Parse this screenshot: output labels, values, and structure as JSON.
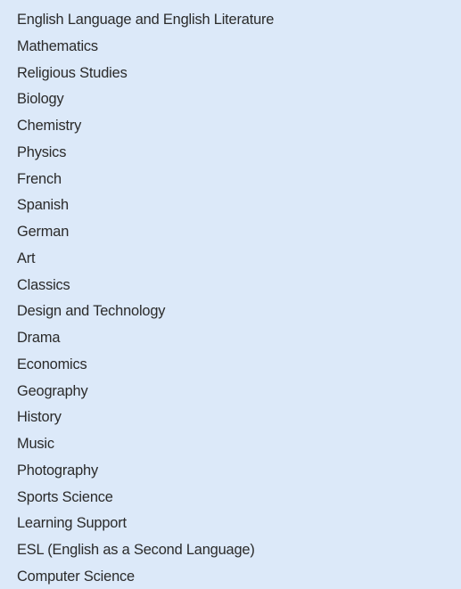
{
  "panel": {
    "name": "subject-list",
    "background_color": "#dce9f9",
    "text_color": "#2a2a2a",
    "item_count": 22
  },
  "subjects": [
    {
      "label": "English Language and English Literature"
    },
    {
      "label": "Mathematics"
    },
    {
      "label": "Religious Studies"
    },
    {
      "label": "Biology"
    },
    {
      "label": "Chemistry"
    },
    {
      "label": "Physics"
    },
    {
      "label": "French"
    },
    {
      "label": "Spanish"
    },
    {
      "label": "German"
    },
    {
      "label": "Art"
    },
    {
      "label": "Classics"
    },
    {
      "label": "Design and Technology"
    },
    {
      "label": "Drama"
    },
    {
      "label": "Economics"
    },
    {
      "label": "Geography"
    },
    {
      "label": "History"
    },
    {
      "label": "Music"
    },
    {
      "label": "Photography"
    },
    {
      "label": "Sports Science"
    },
    {
      "label": "Learning Support"
    },
    {
      "label": "ESL (English as a Second Language)"
    },
    {
      "label": "Computer Science"
    }
  ]
}
